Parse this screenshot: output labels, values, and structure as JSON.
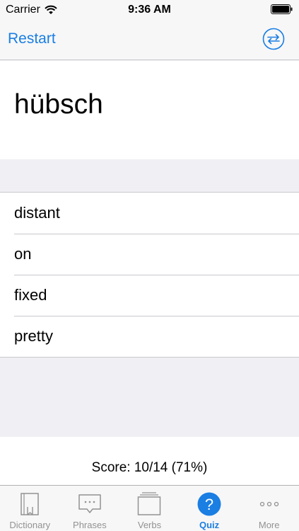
{
  "status": {
    "carrier": "Carrier",
    "time": "9:36 AM"
  },
  "nav": {
    "restart_label": "Restart"
  },
  "quiz": {
    "word": "hübsch",
    "answers": [
      "distant",
      "on",
      "fixed",
      "pretty"
    ],
    "score": "Score: 10/14 (71%)"
  },
  "tabs": [
    {
      "label": "Dictionary",
      "icon": "book-icon"
    },
    {
      "label": "Phrases",
      "icon": "speech-bubble-icon"
    },
    {
      "label": "Verbs",
      "icon": "cards-stack-icon"
    },
    {
      "label": "Quiz",
      "icon": "question-icon",
      "active": true
    },
    {
      "label": "More",
      "icon": "more-dots-icon"
    }
  ],
  "colors": {
    "accent": "#1a7ee3",
    "inactive": "#929292",
    "separator": "#c8c7cc"
  }
}
